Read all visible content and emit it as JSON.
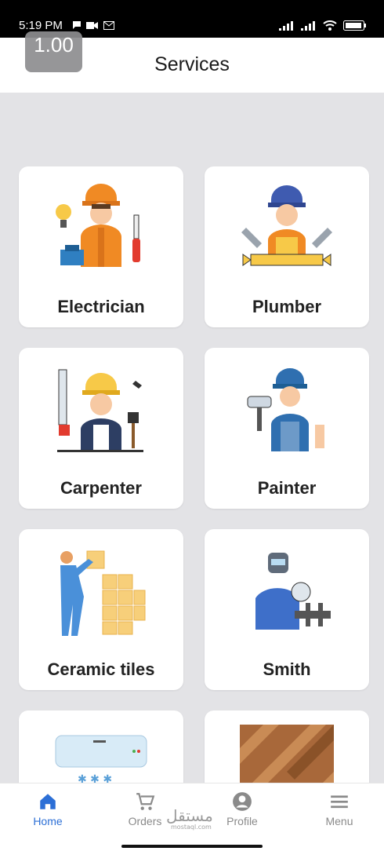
{
  "status": {
    "time": "5:19 PM",
    "left_icons": [
      "message-icon",
      "video-icon",
      "mail-icon"
    ],
    "right_icons": [
      "signal-icon",
      "signal-icon",
      "wifi-icon",
      "battery-icon"
    ]
  },
  "overlay": {
    "zoom": "1.00"
  },
  "header": {
    "title": "Services"
  },
  "services": [
    {
      "label": "Electrician",
      "icon": "electrician-illustration"
    },
    {
      "label": "Plumber",
      "icon": "plumber-illustration"
    },
    {
      "label": "Carpenter",
      "icon": "carpenter-illustration"
    },
    {
      "label": "Painter",
      "icon": "painter-illustration"
    },
    {
      "label": "Ceramic tiles",
      "icon": "tiler-illustration"
    },
    {
      "label": "Smith",
      "icon": "welder-illustration"
    },
    {
      "label": "",
      "icon": "air-conditioner-illustration"
    },
    {
      "label": "",
      "icon": "parquet-floor-illustration"
    }
  ],
  "nav": {
    "items": [
      {
        "label": "Home",
        "icon": "home-icon",
        "active": true
      },
      {
        "label": "Orders",
        "icon": "cart-icon",
        "active": false
      },
      {
        "label": "Profile",
        "icon": "profile-icon",
        "active": false
      },
      {
        "label": "Menu",
        "icon": "menu-icon",
        "active": false
      }
    ]
  },
  "watermark": {
    "text": "مستقل",
    "sub": "mostaql.com"
  },
  "colors": {
    "accent": "#2c6fd6",
    "background": "#e3e3e6",
    "card": "#ffffff",
    "inactive": "#8a8a8a"
  }
}
